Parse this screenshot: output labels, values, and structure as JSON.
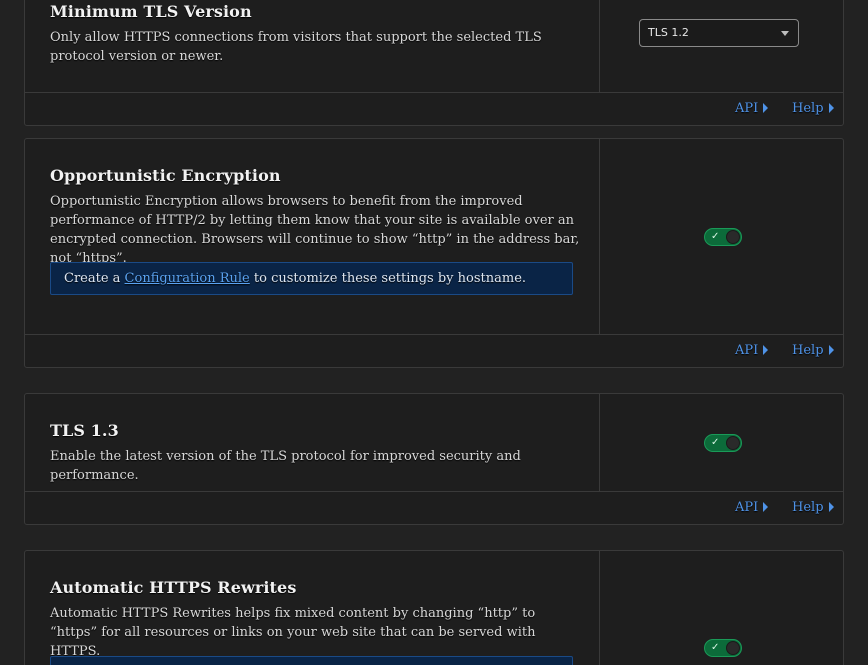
{
  "cards": [
    {
      "title": "Minimum TLS Version",
      "description": "Only allow HTTPS connections from visitors that support the selected TLS protocol version or newer.",
      "control": {
        "type": "select",
        "value": "TLS 1.2"
      },
      "footer": {
        "api_label": "API",
        "help_label": "Help"
      }
    },
    {
      "title": "Opportunistic Encryption",
      "description": "Opportunistic Encryption allows browsers to benefit from the improved performance of HTTP/2 by letting them know that your site is available over an encrypted connection. Browsers will continue to show “http” in the address bar, not “https”.",
      "info": {
        "prefix": "Create a",
        "link": "Configuration Rule",
        "suffix": "to customize these settings by hostname."
      },
      "control": {
        "type": "toggle",
        "state": "on",
        "check_glyph": "✓"
      },
      "footer": {
        "api_label": "API",
        "help_label": "Help"
      }
    },
    {
      "title": "TLS 1.3",
      "description": "Enable the latest version of the TLS protocol for improved security and performance.",
      "control": {
        "type": "toggle",
        "state": "on",
        "check_glyph": "✓"
      },
      "footer": {
        "api_label": "API",
        "help_label": "Help"
      }
    },
    {
      "title": "Automatic HTTPS Rewrites",
      "description": "Automatic HTTPS Rewrites helps fix mixed content by changing “http” to “https” for all resources or links on your web site that can be served with HTTPS.",
      "control": {
        "type": "toggle",
        "state": "on",
        "check_glyph": "✓"
      }
    }
  ],
  "colors": {
    "background": "#222222",
    "card": "#1e1e1e",
    "toggle_on": "#0c6b3a",
    "link": "#4f93e8",
    "info_box": "#0a2446"
  }
}
